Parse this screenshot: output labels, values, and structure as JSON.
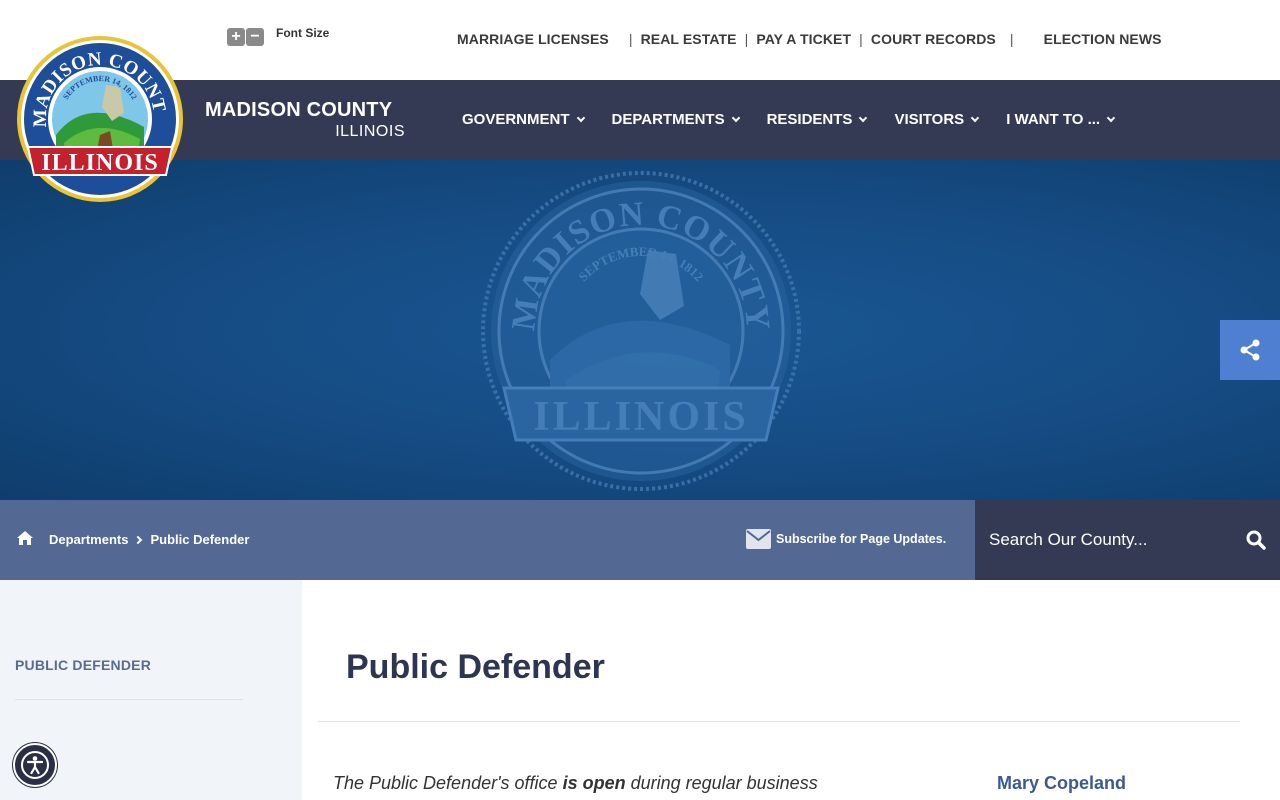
{
  "utility": {
    "font_size_label": "Font Size",
    "increase": "+",
    "decrease": "−",
    "quick_links": [
      "MARRIAGE LICENSES",
      "REAL ESTATE",
      "PAY A TICKET",
      "COURT RECORDS",
      "ELECTION NEWS"
    ]
  },
  "brand": {
    "name": "MADISON COUNTY",
    "state": "ILLINOIS",
    "seal_top_text": "MADISON COUNTY",
    "seal_date": "SEPTEMBER 14, 1812",
    "seal_banner": "ILLINOIS"
  },
  "nav": {
    "items": [
      "GOVERNMENT",
      "DEPARTMENTS",
      "RESIDENTS",
      "VISITORS",
      "I WANT TO ..."
    ]
  },
  "breadcrumb": {
    "items": [
      "Departments",
      "Public Defender"
    ]
  },
  "subscribe": {
    "label": "Subscribe for Page Updates."
  },
  "search": {
    "placeholder": "Search Our County..."
  },
  "sidebar": {
    "items": [
      "PUBLIC DEFENDER"
    ]
  },
  "content": {
    "title": "Public Defender",
    "intro_before": "The Public Defender's office ",
    "intro_bold": "is open",
    "intro_after": " during regular business",
    "contact_name": "Mary Copeland"
  },
  "colors": {
    "nav_bg": "#343a54",
    "hero_blue": "#154b82",
    "crumb_bg": "#536994",
    "share_bg": "#4f7fd1",
    "sidebar_bg": "#f1f4f8",
    "title_text": "#2e3550",
    "link_blue": "#3c5a92"
  }
}
